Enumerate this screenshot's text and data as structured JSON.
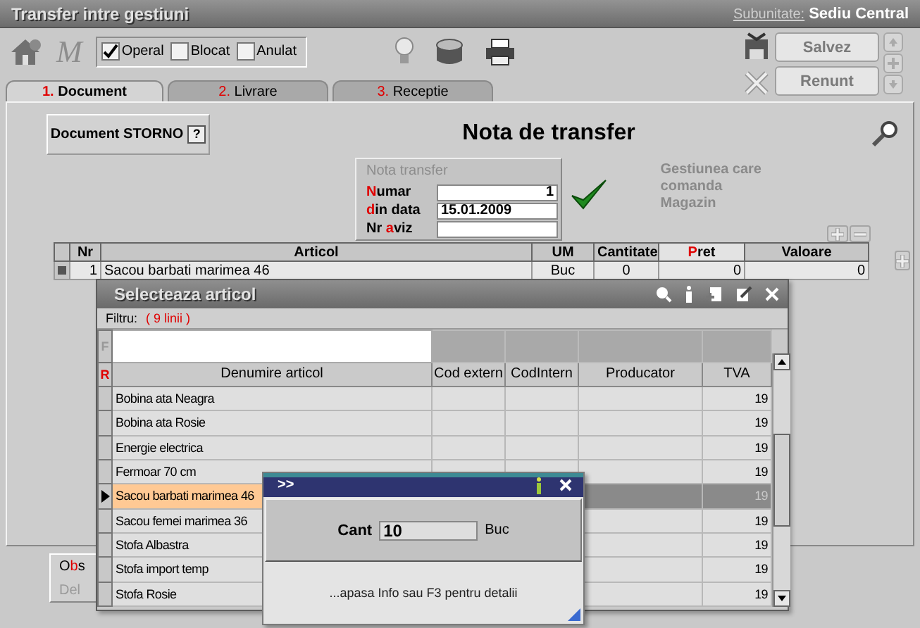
{
  "window": {
    "title": "Transfer intre gestiuni",
    "subunit_label": "Subunitate:",
    "subunit": "Sediu Central"
  },
  "toolbar": {
    "script_glyph": "M"
  },
  "flags": [
    {
      "label": "Operal",
      "checked": true
    },
    {
      "label": "Blocat",
      "checked": false
    },
    {
      "label": "Anulat",
      "checked": false
    }
  ],
  "actions": [
    "Salvez",
    "Renunt"
  ],
  "tabs": [
    {
      "number": "1.",
      "label": "Document",
      "selected": true
    },
    {
      "number": "2.",
      "label": "Livrare",
      "selected": false
    },
    {
      "number": "3.",
      "label": "Receptie",
      "selected": false
    }
  ],
  "document": {
    "storno_button": "Document STORNO",
    "help": "?",
    "title": "Nota de transfer",
    "group_title": "Nota transfer",
    "fields": [
      {
        "parts": [
          {
            "t": "N",
            "hot": true
          },
          {
            "t": "umar"
          }
        ],
        "value": "1",
        "kind": "number"
      },
      {
        "parts": [
          {
            "t": "d",
            "hot": true
          },
          {
            "t": "in data"
          }
        ],
        "value": "15.01.2009",
        "kind": "date"
      },
      {
        "parts": [
          {
            "t": "Nr "
          },
          {
            "t": "a",
            "hot": true
          },
          {
            "t": "viz"
          }
        ],
        "kind": "text"
      }
    ],
    "gestiune_label": "Gestiunea care comanda",
    "gestiune": "Magazin"
  },
  "items_table": {
    "columns": [
      {
        "parts": [
          {
            "t": "Nr"
          }
        ],
        "sorted": false
      },
      {
        "parts": [
          {
            "t": "Articol"
          }
        ],
        "sorted": false
      },
      {
        "parts": [
          {
            "t": "UM"
          }
        ],
        "sorted": false
      },
      {
        "parts": [
          {
            "t": "Cantitate"
          }
        ],
        "sorted": false
      },
      {
        "parts": [
          {
            "t": "P",
            "hot": true
          },
          {
            "t": "ret"
          }
        ],
        "sorted": true
      },
      {
        "parts": [
          {
            "t": "Valoare"
          }
        ],
        "sorted": false
      }
    ],
    "rows": [
      {
        "cells": [
          "1",
          "Sacou barbati marimea 46",
          "Buc",
          "0",
          "0",
          "0"
        ]
      }
    ]
  },
  "obs_panel": {
    "parts": [
      {
        "t": "O"
      },
      {
        "t": "b",
        "hot": true
      },
      {
        "t": "s"
      }
    ],
    "delete_label": "Del"
  },
  "picker": {
    "title": "Selecteaza articol",
    "filter_label": "Filtru:",
    "filter_count": "( 9 linii )",
    "filter_marker": "F",
    "header_marker": "R",
    "columns": [
      "Denumire articol",
      "Cod extern",
      "CodIntern",
      "Producator",
      "TVA"
    ],
    "rows": [
      {
        "name": "Bobina ata Neagra",
        "tva": "19",
        "selected": false
      },
      {
        "name": "Bobina ata Rosie",
        "tva": "19",
        "selected": false
      },
      {
        "name": "Energie electrica",
        "tva": "19",
        "selected": false
      },
      {
        "name": "Fermoar 70 cm",
        "tva": "19",
        "selected": false
      },
      {
        "name": "Sacou barbati marimea 46",
        "tva": "19",
        "selected": true
      },
      {
        "name": "Sacou femei marimea 36",
        "tva": "19",
        "selected": false
      },
      {
        "name": "Stofa Albastra",
        "tva": "19",
        "selected": false
      },
      {
        "name": "Stofa import temp",
        "tva": "19",
        "selected": false
      },
      {
        "name": "Stofa Rosie",
        "tva": "19",
        "selected": false
      }
    ]
  },
  "quantity_dialog": {
    "title": ">>",
    "label": "Cant",
    "value": "10",
    "unit": "Buc",
    "hint": "...apasa Info sau F3 pentru detalii"
  }
}
